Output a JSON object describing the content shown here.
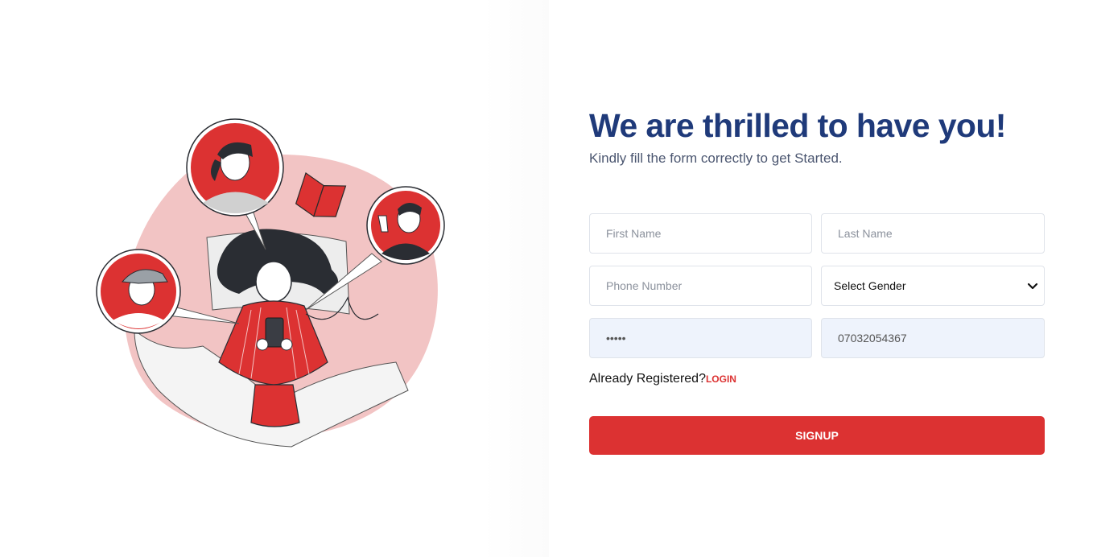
{
  "page": {
    "heading": "We are thrilled to have you!",
    "subheading": "Kindly fill the form correctly to get Started."
  },
  "form": {
    "first_name": {
      "placeholder": "First Name",
      "value": ""
    },
    "last_name": {
      "placeholder": "Last Name",
      "value": ""
    },
    "phone": {
      "placeholder": "Phone Number",
      "value": ""
    },
    "gender": {
      "selected": "Select Gender"
    },
    "password": {
      "value": "•••••"
    },
    "confirm": {
      "value": "07032054367"
    }
  },
  "login_prompt": {
    "text": "Already Registered?",
    "link": "LOGIN"
  },
  "signup_label": "SIGNUP",
  "colors": {
    "accent": "#dc3232",
    "heading": "#1f3a7a",
    "illustration_bg": "#f2c4c4"
  },
  "icons": [
    "chevron-down-icon"
  ]
}
